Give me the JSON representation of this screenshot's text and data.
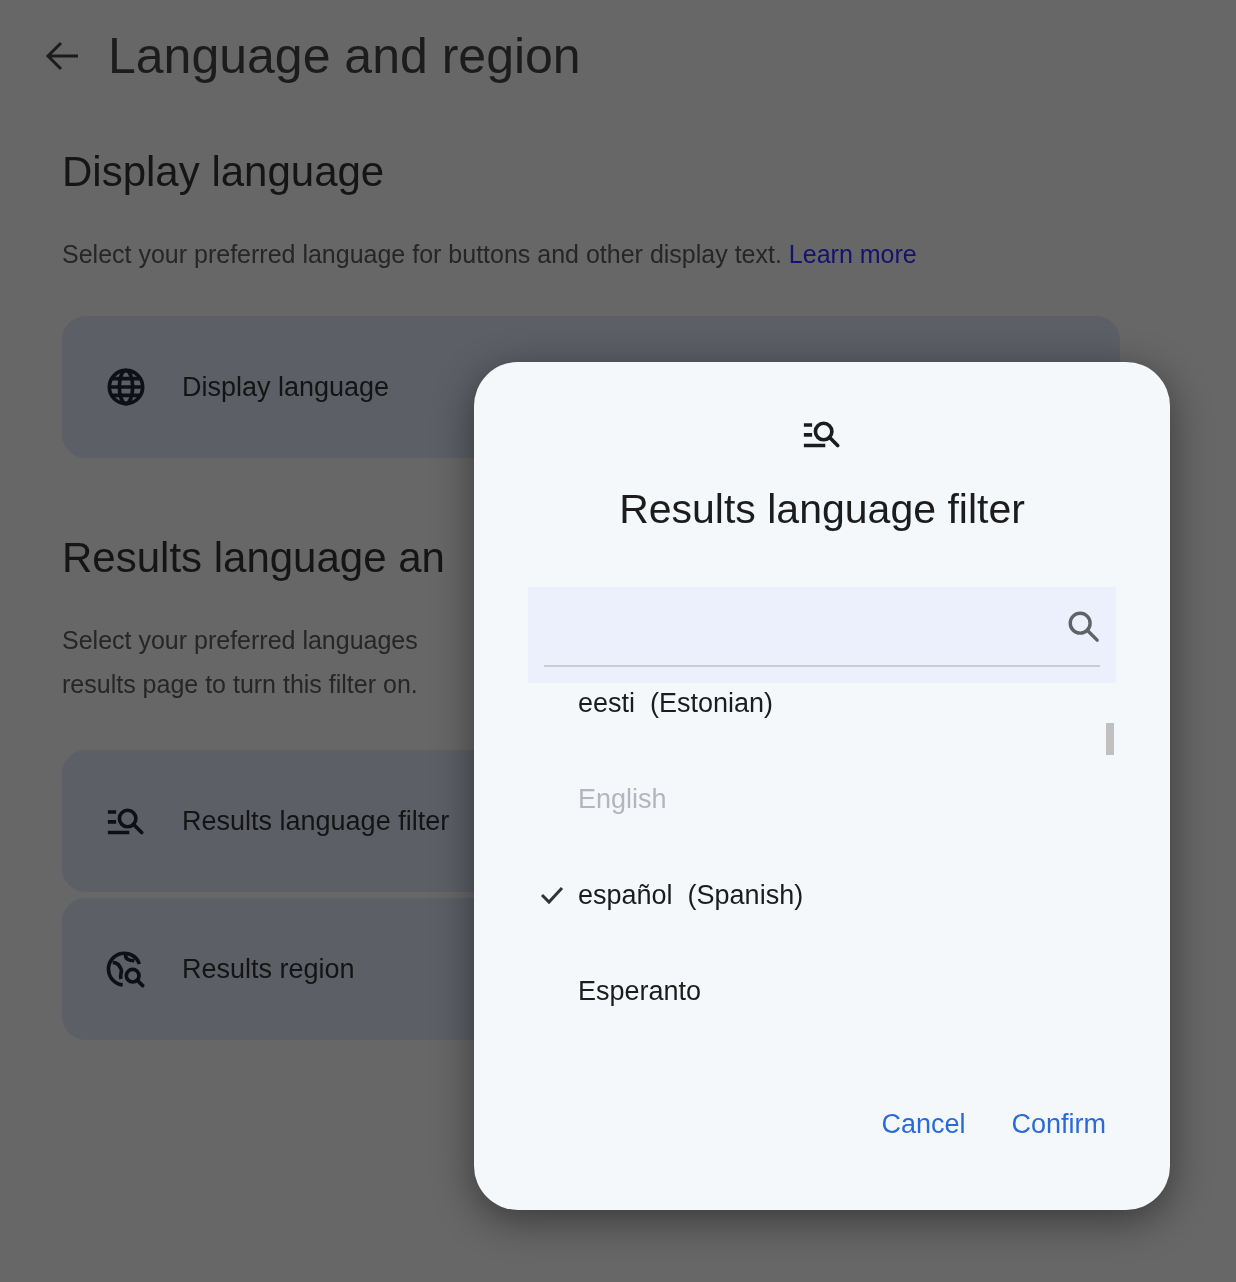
{
  "header": {
    "title": "Language and region"
  },
  "sections": [
    {
      "heading": "Display language",
      "lines": [
        "Select your preferred language for buttons and other display text."
      ],
      "link": "Learn more",
      "rows": [
        {
          "label": "Display language",
          "kind": "globe"
        }
      ]
    },
    {
      "heading": "Results language an",
      "lines": [
        "Select your preferred languages",
        "results page to turn this filter on."
      ],
      "rows": [
        {
          "label": "Results language filter",
          "kind": "filter-search"
        },
        {
          "label": "Results region",
          "kind": "globe-search"
        }
      ]
    }
  ],
  "dialog": {
    "title": "Results language filter",
    "languages": [
      {
        "name": "eesti  (Estonian)",
        "checked": false,
        "disabled": false
      },
      {
        "name": "English",
        "checked": false,
        "disabled": true
      },
      {
        "name": "español  (Spanish)",
        "checked": true,
        "disabled": false
      },
      {
        "name": "Esperanto",
        "checked": false,
        "disabled": false
      }
    ],
    "buttons": [
      "Cancel",
      "Confirm"
    ]
  }
}
